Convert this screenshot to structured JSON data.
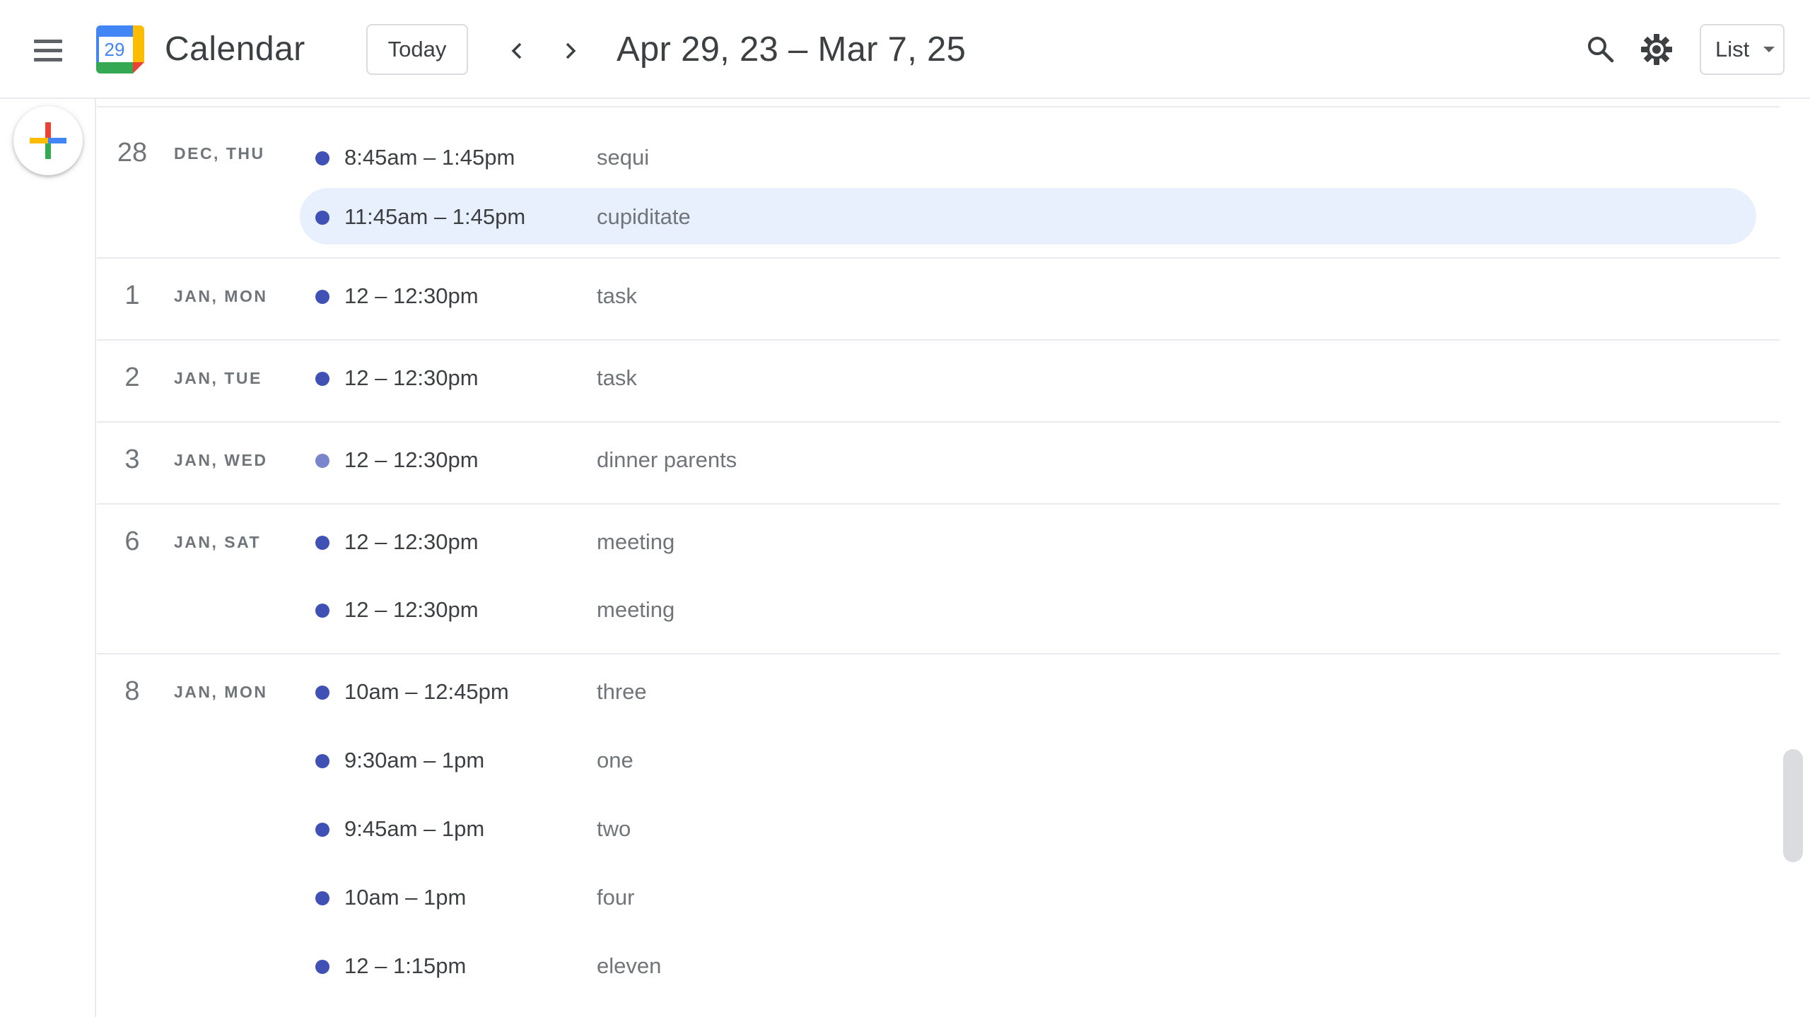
{
  "header": {
    "menu_icon": "hamburger-menu-icon",
    "logo_day": "29",
    "app_title": "Calendar",
    "today_label": "Today",
    "prev_icon": "chevron-left-icon",
    "next_icon": "chevron-right-icon",
    "date_range": "Apr 29, 23 – Mar 7, 25",
    "search_icon": "search-icon",
    "settings_icon": "gear-icon",
    "view_label": "List"
  },
  "colors": {
    "event_dot": "#3f51b5",
    "event_dot_light": "#7986cb",
    "selected_bg": "#e8f0fe",
    "text_primary": "#3c4043",
    "text_secondary": "#70757a"
  },
  "days": [
    {
      "num": "28",
      "label": "DEC, THU",
      "events": [
        {
          "time": "8:45am – 1:45pm",
          "title": "sequi"
        },
        {
          "time": "11:45am – 1:45pm",
          "title": "cupiditate",
          "selected": true
        }
      ]
    },
    {
      "num": "1",
      "label": "JAN, MON",
      "events": [
        {
          "time": "12 – 12:30pm",
          "title": "task"
        }
      ]
    },
    {
      "num": "2",
      "label": "JAN, TUE",
      "events": [
        {
          "time": "12 – 12:30pm",
          "title": "task"
        }
      ]
    },
    {
      "num": "3",
      "label": "JAN, WED",
      "events": [
        {
          "time": "12 – 12:30pm",
          "title": "dinner parents",
          "light": true
        }
      ]
    },
    {
      "num": "6",
      "label": "JAN, SAT",
      "events": [
        {
          "time": "12 – 12:30pm",
          "title": "meeting"
        },
        {
          "time": "12 – 12:30pm",
          "title": "meeting"
        }
      ]
    },
    {
      "num": "8",
      "label": "JAN, MON",
      "events": [
        {
          "time": "10am – 12:45pm",
          "title": "three"
        },
        {
          "time": "9:30am – 1pm",
          "title": "one"
        },
        {
          "time": "9:45am – 1pm",
          "title": "two"
        },
        {
          "time": "10am – 1pm",
          "title": "four"
        },
        {
          "time": "12 – 1:15pm",
          "title": "eleven"
        }
      ]
    }
  ]
}
